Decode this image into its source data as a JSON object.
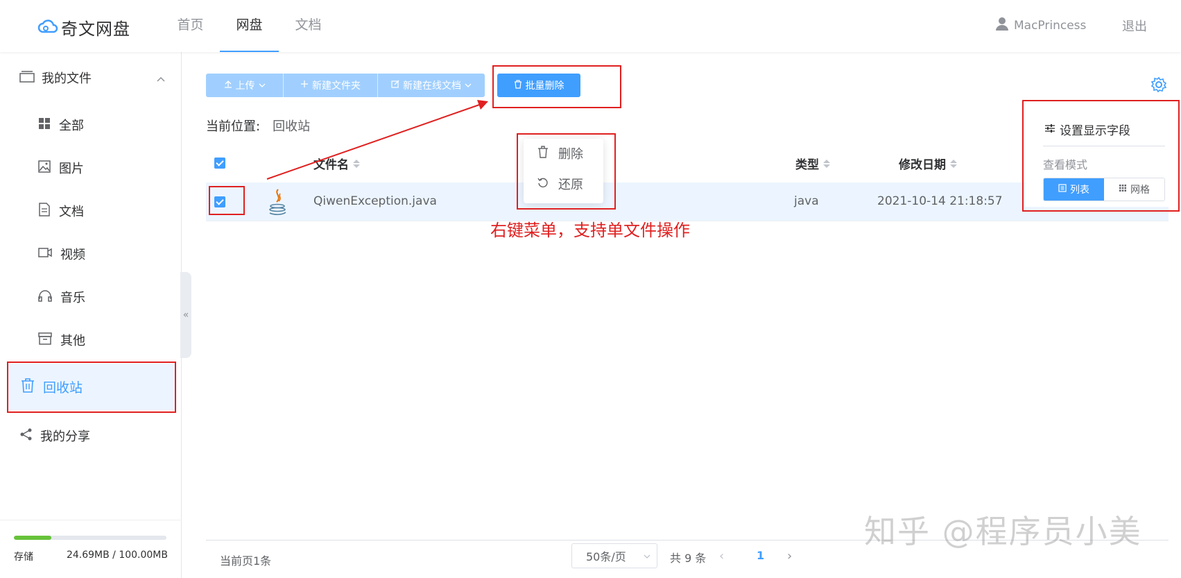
{
  "app": {
    "logo": "奇文网盘"
  },
  "nav": {
    "items": [
      "首页",
      "网盘",
      "文档"
    ],
    "active": "网盘"
  },
  "user": {
    "name": "MacPrincess",
    "logout": "退出"
  },
  "sidebar": {
    "my_files": "我的文件",
    "items": [
      "全部",
      "图片",
      "文档",
      "视频",
      "音乐",
      "其他"
    ],
    "recycle": "回收站",
    "share": "我的分享",
    "storage_label": "存储",
    "storage_value": "24.69MB / 100.00MB",
    "storage_fraction": 0.2469
  },
  "toolbar": {
    "upload": "上传",
    "new_folder": "新建文件夹",
    "new_doc": "新建在线文档",
    "batch_delete": "批量删除"
  },
  "location": {
    "label": "当前位置:",
    "value": "回收站"
  },
  "table": {
    "headers": {
      "name": "文件名",
      "type": "类型",
      "date": "修改日期"
    },
    "rows": [
      {
        "name": "QiwenException.java",
        "type": "java",
        "date": "2021-10-14 21:18:57"
      }
    ]
  },
  "context_menu": {
    "delete": "删除",
    "restore": "还原"
  },
  "view_settings": {
    "title": "设置显示字段",
    "mode_label": "查看模式",
    "list": "列表",
    "grid": "网格"
  },
  "annotation": "右键菜单，支持单文件操作",
  "footer": {
    "current": "当前页1条",
    "page_size": "50条/页",
    "total": "共 9 条",
    "page": "1"
  },
  "watermark": "知乎 @程序员小美",
  "colors": {
    "accent": "#409eff",
    "annotation": "#e02020",
    "storage_bar": "#67c23a"
  }
}
